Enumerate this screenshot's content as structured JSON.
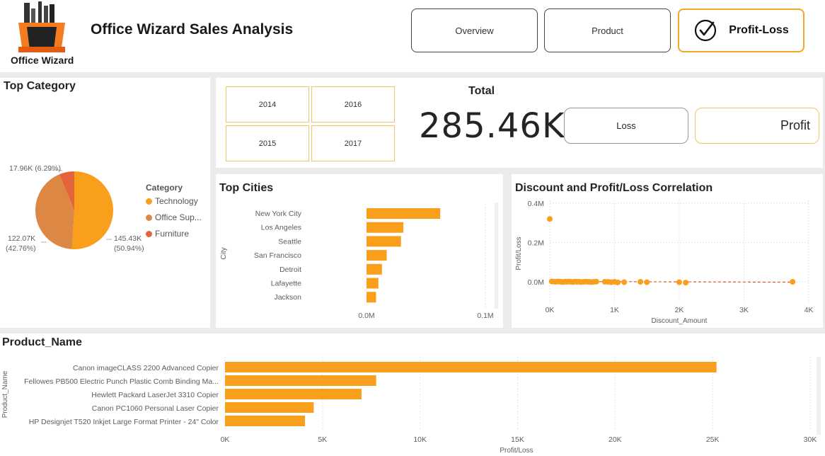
{
  "header": {
    "logo_text": "Office Wizard",
    "title": "Office Wizard Sales Analysis",
    "nav": [
      {
        "label": "Overview",
        "active": false
      },
      {
        "label": "Product",
        "active": false
      },
      {
        "label": "Profit-Loss",
        "active": true
      }
    ]
  },
  "colors": {
    "accent": "#f5a623",
    "bar": "#f99f1c",
    "technology": "#f99f1c",
    "office_supplies": "#dd8744",
    "furniture": "#e2653b",
    "trend": "#e35b2a"
  },
  "top_category": {
    "title": "Top Category",
    "legend_title": "Category",
    "legend": [
      "Technology",
      "Office Sup...",
      "Furniture"
    ]
  },
  "filters": {
    "years": [
      "2014",
      "2016",
      "2015",
      "2017"
    ]
  },
  "kpi": {
    "label": "Total",
    "value": "285.46K",
    "loss_label": "Loss",
    "profit_label": "Profit"
  },
  "top_cities": {
    "title": "Top Cities"
  },
  "correlation": {
    "title": "Discount and Profit/Loss Correlation"
  },
  "product_name": {
    "title": "Product_Name"
  },
  "chart_data": [
    {
      "type": "pie",
      "title": "Top Category",
      "legend_title": "Category",
      "categories": [
        "Technology",
        "Office Supplies",
        "Furniture"
      ],
      "values": [
        145.43,
        122.07,
        17.96
      ],
      "value_labels": [
        "145.43K",
        "122.07K",
        "17.96K"
      ],
      "percent_labels": [
        "(50.94%)",
        "(42.76%)",
        "(6.29%)"
      ],
      "legend_position": "right"
    },
    {
      "type": "bar",
      "orientation": "horizontal",
      "title": "Top Cities",
      "ylabel": "City",
      "categories": [
        "New York City",
        "Los Angeles",
        "Seattle",
        "San Francisco",
        "Detroit",
        "Lafayette",
        "Jackson"
      ],
      "values": [
        0.062,
        0.031,
        0.029,
        0.017,
        0.013,
        0.01,
        0.008
      ],
      "xlim": [
        0,
        0.1
      ],
      "xticks": [
        "0.0M",
        "0.1M"
      ]
    },
    {
      "type": "scatter",
      "title": "Discount and Profit/Loss Correlation",
      "xlabel": "Discount_Amount",
      "ylabel": "Profit/Loss",
      "xlim": [
        0,
        4000
      ],
      "ylim": [
        -0.03,
        0.4
      ],
      "xticks": [
        "0K",
        "1K",
        "2K",
        "3K",
        "4K"
      ],
      "yticks": [
        "0.0M",
        "0.2M",
        "0.4M"
      ],
      "x": [
        0,
        30,
        60,
        90,
        120,
        150,
        180,
        210,
        240,
        270,
        300,
        330,
        360,
        390,
        420,
        450,
        480,
        520,
        560,
        600,
        640,
        680,
        720,
        850,
        900,
        950,
        1000,
        1050,
        1150,
        1400,
        1500,
        2000,
        2100,
        3750
      ],
      "y": [
        0.32,
        0.002,
        0.001,
        0.0,
        0.002,
        0.001,
        0.0,
        -0.001,
        0.001,
        0.0,
        0.002,
        0.0,
        -0.001,
        0.001,
        0.0,
        0.001,
        -0.001,
        0.0,
        0.001,
        0.0,
        -0.001,
        0.0,
        0.001,
        0.0,
        0.0,
        -0.002,
        0.0,
        -0.003,
        -0.002,
        0.0,
        -0.002,
        -0.002,
        -0.004,
        0.0
      ],
      "trendline": true
    },
    {
      "type": "bar",
      "orientation": "horizontal",
      "title": "Product_Name",
      "xlabel": "Profit/Loss",
      "ylabel": "Product_Name",
      "categories": [
        "Canon imageCLASS 2200 Advanced Copier",
        "Fellowes PB500 Electric Punch Plastic Comb Binding Ma...",
        "Hewlett Packard LaserJet 3310 Copier",
        "Canon PC1060 Personal Laser Copier",
        "HP Designjet T520 Inkjet Large Format Printer - 24\" Color"
      ],
      "values": [
        25200,
        7750,
        7000,
        4550,
        4100
      ],
      "xlim": [
        0,
        30000
      ],
      "xticks": [
        "0K",
        "5K",
        "10K",
        "15K",
        "20K",
        "25K",
        "30K"
      ]
    }
  ]
}
